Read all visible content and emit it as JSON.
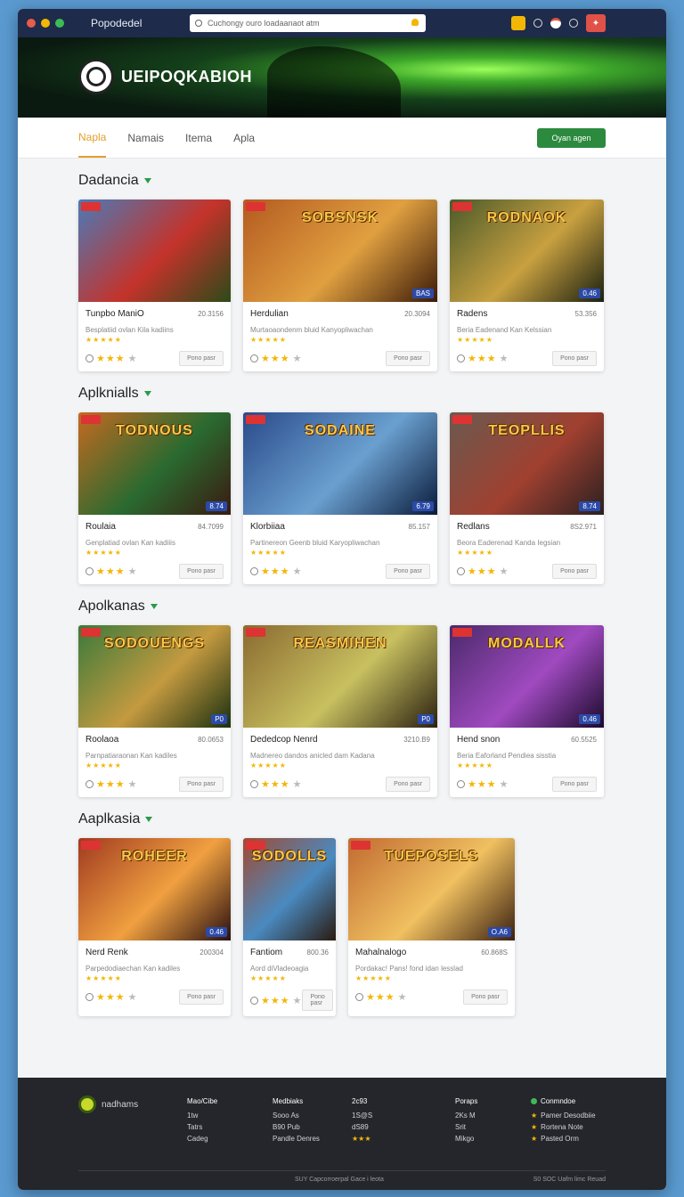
{
  "titlebar": {
    "app_title": "Popodedel",
    "search_placeholder": "Cuchongy ouro loadaanaot atm"
  },
  "hero": {
    "title": "UEIPOQKABIOH"
  },
  "nav": {
    "tabs": [
      "Napla",
      "Namais",
      "Itema",
      "Apla"
    ],
    "active_tab": "Napla",
    "button_label": "Oyan agen"
  },
  "sections": [
    {
      "title": "Dadancia",
      "cards": [
        {
          "img_text": "",
          "name": "Tunpbo ManiO",
          "price": "20.3156",
          "desc": "Besplatiid ovlan Kila kadiins",
          "badge": ""
        },
        {
          "img_text": "SOBSNSK",
          "name": "Herdulian",
          "price": "20.3094",
          "desc": "Murtaoaondenm bluid Kanyopliwachan",
          "badge": "BAS"
        },
        {
          "img_text": "RODNAOK",
          "name": "Radens",
          "price": "53.356",
          "desc": "Beria Eadenand Kan Kelssian",
          "badge": "0.46"
        }
      ]
    },
    {
      "title": "Aplknialls",
      "cards": [
        {
          "img_text": "TODNOUS",
          "name": "Roulaia",
          "price": "84.7099",
          "desc": "Genplatiad ovlan Kan kadiiis",
          "badge": "8.74"
        },
        {
          "img_text": "SODAINE",
          "name": "Klorbiiaa",
          "price": "85.157",
          "desc": "Partinereon Geenb bluid Karyopliwachan",
          "badge": "6.79"
        },
        {
          "img_text": "TEOPLLIS",
          "name": "Redlans",
          "price": "8S2.971",
          "desc": "Beora Eaderenad Kanda Iegsian",
          "badge": "8.74"
        }
      ]
    },
    {
      "title": "Apolkanas",
      "cards": [
        {
          "img_text": "SODOUENGS",
          "name": "Roolaoa",
          "price": "80.0653",
          "desc": "Parnpatiaraonan Kan kadiles",
          "badge": "P0"
        },
        {
          "img_text": "REASMIHEN",
          "name": "Dededcop Nenrd",
          "price": "3210.B9",
          "desc": "Madnereo dandos anicled dam Kadana",
          "badge": "P0"
        },
        {
          "img_text": "MODALLK",
          "name": "Hend snon",
          "price": "60.5525",
          "desc": "Beria Eaforland Pendiea sisstia",
          "badge": "0.46"
        }
      ]
    },
    {
      "title": "Aaplkasia",
      "cards": [
        {
          "img_text": "ROHEER",
          "name": "Nerd Renk",
          "price": "200304",
          "desc": "Parpedodiaechan Kan kadiles",
          "badge": "0.46"
        },
        {
          "img_text": "SODOLLS",
          "name": "Fantiom",
          "price": "800.36",
          "desc": "Aord diVladeoagia",
          "badge": ""
        },
        {
          "img_text": "TUEPOSELS",
          "name": "Mahalnalogo",
          "price": "60.868S",
          "desc": "Pordakac! Pans! fond idan lesslad",
          "badge": "O.A6"
        }
      ]
    }
  ],
  "card_button_label": "Pono pasr",
  "footer": {
    "brand": "nadhams",
    "columns": [
      {
        "head": "Mao/Cibe",
        "items": [
          "1tw",
          "Tatrs",
          "Cadeg"
        ]
      },
      {
        "head": "Medbiaks",
        "items": [
          "Sooo As",
          "B90 Pub",
          "Pandle Denres"
        ]
      },
      {
        "head": "2c93",
        "items": [
          "1S@S",
          "dS89",
          "★★★"
        ]
      },
      {
        "head": "Poraps",
        "items": [
          "2Ks M",
          "Srit",
          "Mikgo"
        ]
      },
      {
        "head": "Conmndoe",
        "items": [
          "Pamer Desodbiie",
          "Rortena Note",
          "Pasted Orm"
        ]
      }
    ],
    "copyright": "SUY Capcorroerpal Gace i leota",
    "legal": "S0 SOC Uafm limc Reuad"
  }
}
